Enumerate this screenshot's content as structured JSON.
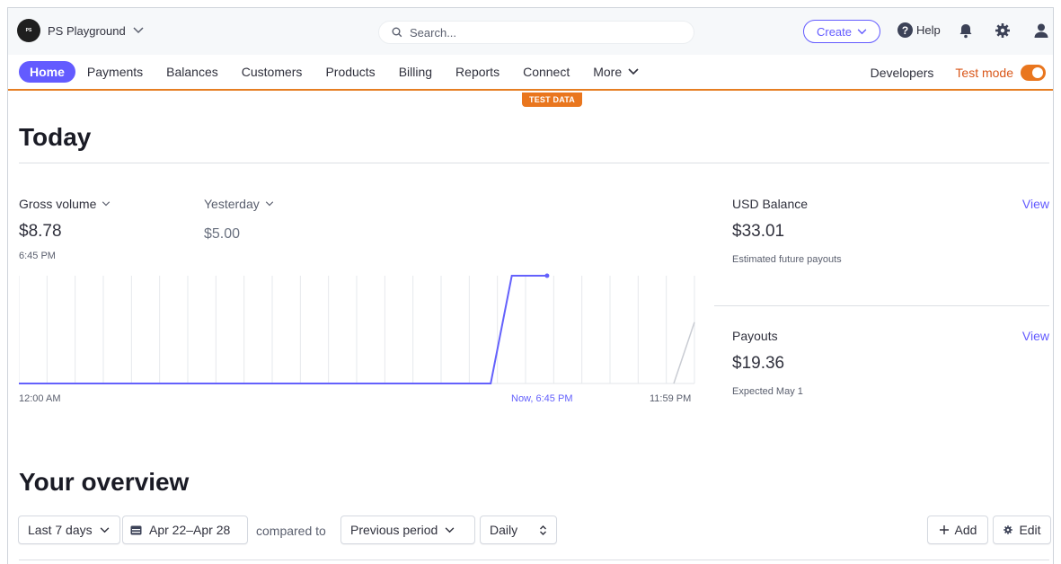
{
  "account": {
    "name": "PS Playground",
    "logo_text": "PS"
  },
  "search": {
    "placeholder": "Search..."
  },
  "header": {
    "create_label": "Create",
    "help_label": "Help"
  },
  "nav": {
    "items": [
      {
        "label": "Home",
        "active": true
      },
      {
        "label": "Payments"
      },
      {
        "label": "Balances"
      },
      {
        "label": "Customers"
      },
      {
        "label": "Products"
      },
      {
        "label": "Billing"
      },
      {
        "label": "Reports"
      },
      {
        "label": "Connect"
      },
      {
        "label": "More"
      }
    ],
    "developers_label": "Developers",
    "test_mode_label": "Test mode",
    "test_mode_on": true
  },
  "banner": {
    "test_data": "TEST DATA"
  },
  "today": {
    "title": "Today",
    "gross_label": "Gross volume",
    "gross_value": "$8.78",
    "gross_time": "6:45 PM",
    "yesterday_label": "Yesterday",
    "yesterday_value": "$5.00",
    "usd_balance_label": "USD Balance",
    "usd_balance_value": "$33.01",
    "usd_balance_note": "Estimated future payouts",
    "payouts_label": "Payouts",
    "payouts_value": "$19.36",
    "payouts_note": "Expected May 1",
    "view_label": "View"
  },
  "chart_data": {
    "type": "line",
    "x_labels": {
      "start": "12:00 AM",
      "now": "Now, 6:45 PM",
      "end": "11:59 PM"
    },
    "series": [
      {
        "name": "",
        "color": "#6461fc",
        "points": [
          [
            "12:00 AM",
            0
          ],
          [
            "4:45 PM",
            0
          ],
          [
            "5:30 PM",
            8.78
          ],
          [
            "6:45 PM",
            8.78
          ]
        ]
      },
      {
        "name": "",
        "color": "#c9ccd3",
        "points": [
          [
            "11:15 PM",
            0
          ],
          [
            "11:59 PM",
            5.0
          ]
        ]
      }
    ],
    "ylim": [
      0,
      8.78
    ],
    "grid": "vertical"
  },
  "overview": {
    "title": "Your overview",
    "range_label": "Last 7 days",
    "date_label": "Apr 22–Apr 28",
    "compared_label": "compared to",
    "compare_label": "Previous period",
    "interval_label": "Daily",
    "add_label": "Add",
    "edit_label": "Edit"
  },
  "colors": {
    "accent": "#635bff",
    "test_mode": "#e9761e"
  }
}
